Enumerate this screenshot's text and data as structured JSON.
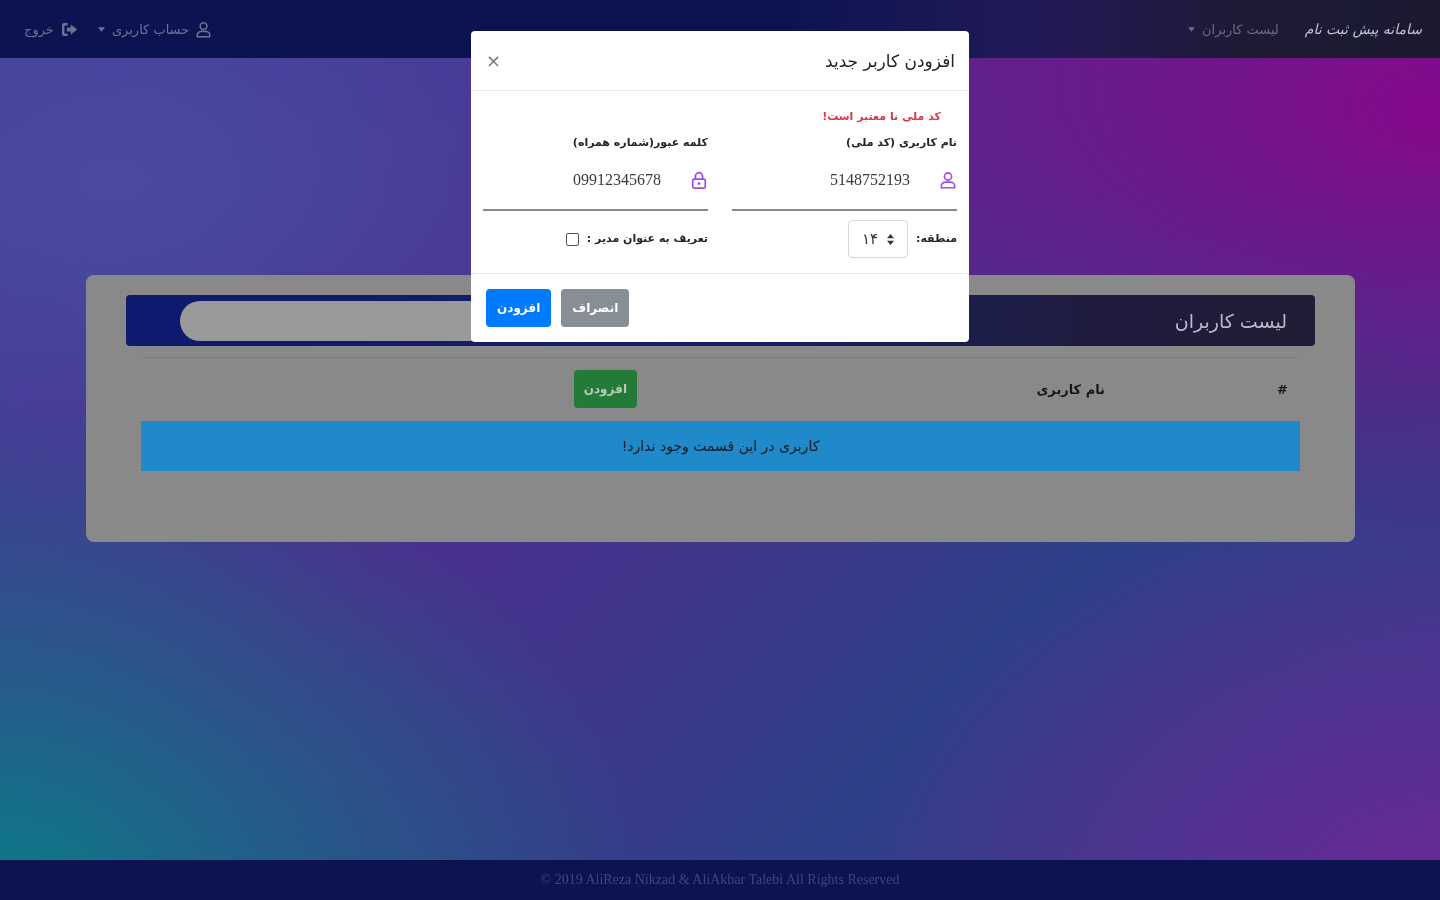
{
  "navbar": {
    "brand": "سامانه پیش ثبت نام",
    "menu": [
      {
        "label": "لیست کاربران",
        "dropdown": true
      }
    ],
    "account": {
      "label": "حساب کاربری",
      "dropdown": true
    },
    "logout": {
      "label": "خروج"
    }
  },
  "card": {
    "title": "لیست کاربران",
    "table": {
      "columns": [
        "#",
        "نام کاربری"
      ],
      "add_button": "افزودن",
      "empty_message": "کاربری در این قسمت وجود ندارد!"
    }
  },
  "modal": {
    "title": "افزودن کاربر جدید",
    "close": "×",
    "fields": [
      {
        "kind": "username",
        "error": "کد ملی نا معتبر است!",
        "label": "نام کاربری (کد ملی)",
        "value": "5148752193"
      },
      {
        "kind": "password",
        "label": "کلمه عبور(شماره همراه)",
        "value": "09912345678"
      }
    ],
    "region": {
      "label": "منطقه:",
      "value": "۱۴"
    },
    "admin": {
      "label": "تعریف به عنوان مدیر :",
      "checked": false
    },
    "buttons": [
      {
        "kind": "secondary",
        "label": "انصراف"
      },
      {
        "kind": "primary",
        "label": "افزودن"
      }
    ]
  },
  "footer": {
    "text": "© 2019 AliReza Nikzad & AliAkbar Talebi All Rights Reserved"
  }
}
